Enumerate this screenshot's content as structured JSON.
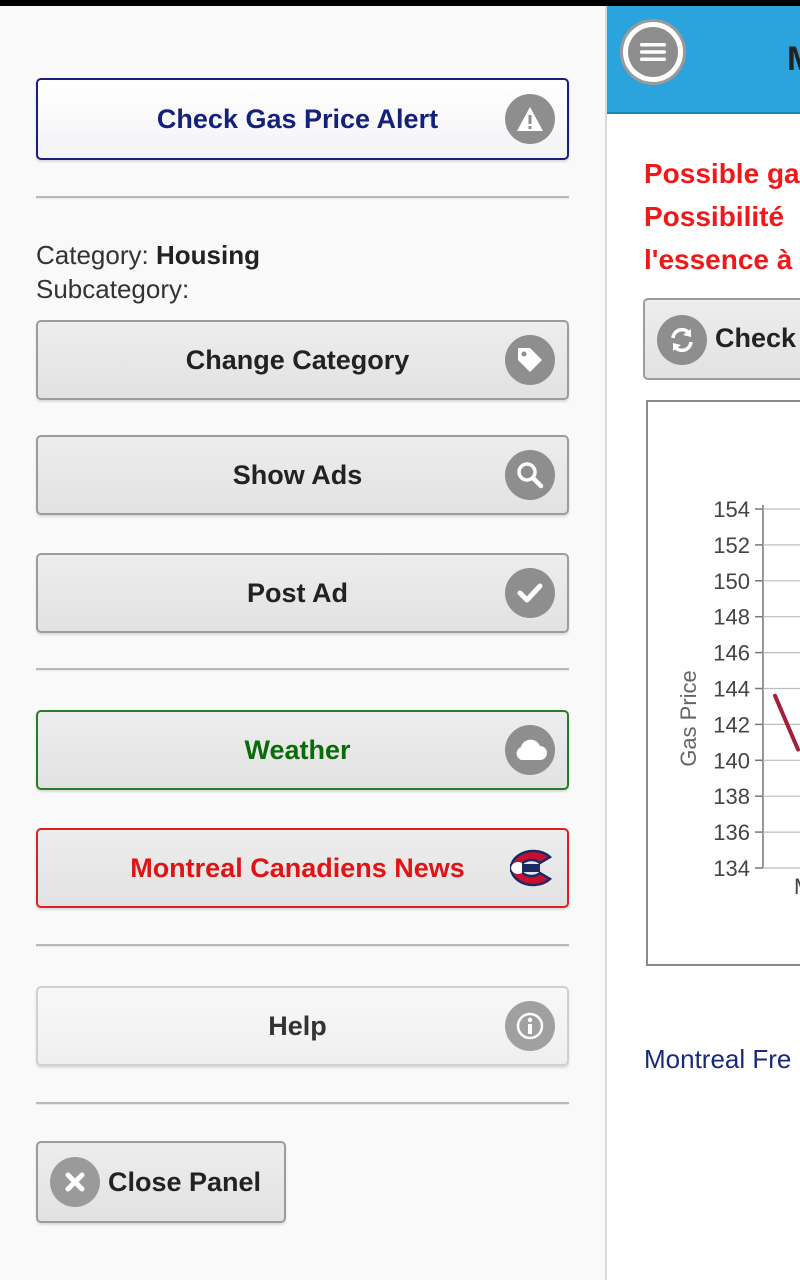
{
  "sidebar": {
    "gas_alert_label": "Check Gas Price Alert",
    "category_prefix": "Category:",
    "category_value": "Housing",
    "subcategory_prefix": "Subcategory:",
    "change_category_label": "Change Category",
    "show_ads_label": "Show Ads",
    "post_ad_label": "Post Ad",
    "weather_label": "Weather",
    "canadiens_label": "Montreal Canadiens News",
    "help_label": "Help",
    "close_label": "Close Panel"
  },
  "main": {
    "title_fragment": "M",
    "warning_lines": [
      "Possible ga",
      "Possibilité",
      "l'essence à"
    ],
    "check_label": "Check",
    "footer_link": "Montreal Fre"
  },
  "colors": {
    "topbar": "#2ba3dc",
    "alert_text": "#14217a",
    "weather_text": "#0b6b0b",
    "canadiens_text": "#e01414",
    "warning_text": "#f01818",
    "series_line": "#a3203a"
  },
  "icons": {
    "alert": "warning-icon",
    "change_category": "tag-icon",
    "show_ads": "search-icon",
    "post_ad": "check-icon",
    "weather": "cloud-icon",
    "canadiens": "canadiens-logo-icon",
    "help": "info-icon",
    "close": "close-icon",
    "menu": "menu-icon",
    "refresh": "refresh-icon"
  },
  "chart_data": {
    "type": "line",
    "ylabel": "Gas Price",
    "xlabel": "",
    "ylim": [
      134,
      154
    ],
    "yticks": [
      "154",
      "152",
      "150",
      "148",
      "146",
      "144",
      "142",
      "140",
      "138",
      "136",
      "134"
    ],
    "xtick_fragment": "M",
    "series": [
      {
        "x": [
          0,
          1
        ],
        "values": [
          143.6,
          140.6
        ]
      }
    ]
  }
}
